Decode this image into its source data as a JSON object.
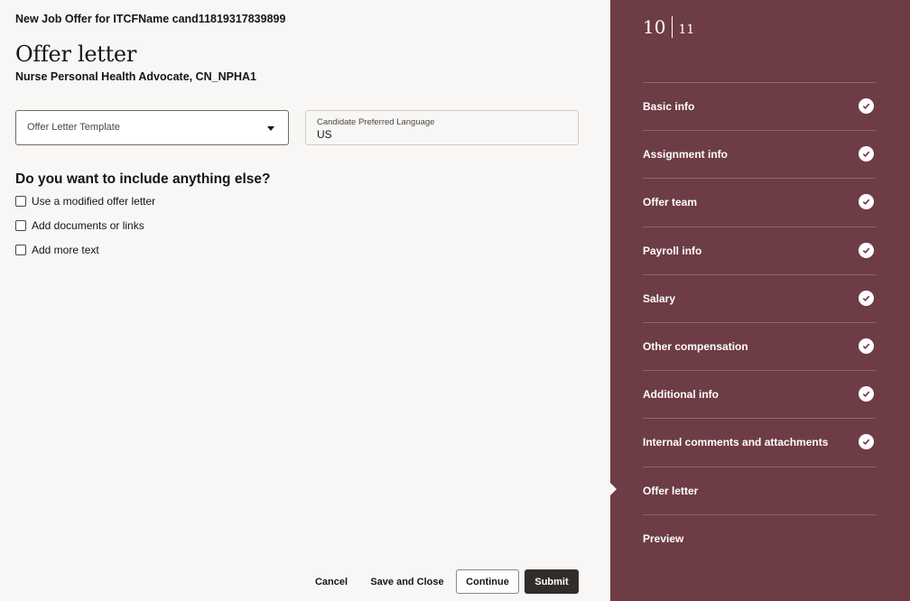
{
  "header": {
    "context": "New Job Offer for ITCFName cand11819317839899",
    "title": "Offer letter",
    "subtitle": "Nurse Personal Health Advocate, CN_NPHA1"
  },
  "form": {
    "template_placeholder": "Offer Letter Template",
    "language_label": "Candidate Preferred Language",
    "language_value": "US",
    "question": "Do you want to include anything else?",
    "options": [
      {
        "label": "Use a modified offer letter",
        "checked": false
      },
      {
        "label": "Add documents or links",
        "checked": false
      },
      {
        "label": "Add more text",
        "checked": false
      }
    ]
  },
  "footer": {
    "cancel": "Cancel",
    "save_close": "Save and Close",
    "continue": "Continue",
    "submit": "Submit"
  },
  "progress": {
    "current": "10",
    "total": "11",
    "steps": [
      {
        "label": "Basic info",
        "complete": true
      },
      {
        "label": "Assignment info",
        "complete": true
      },
      {
        "label": "Offer team",
        "complete": true
      },
      {
        "label": "Payroll info",
        "complete": true
      },
      {
        "label": "Salary",
        "complete": true
      },
      {
        "label": "Other compensation",
        "complete": true
      },
      {
        "label": "Additional info",
        "complete": true
      },
      {
        "label": "Internal comments and attachments",
        "complete": true
      },
      {
        "label": "Offer letter",
        "complete": false,
        "current": true
      },
      {
        "label": "Preview",
        "complete": false
      }
    ]
  },
  "colors": {
    "sidebar": "#6d3c45",
    "primary_button": "#312d2a"
  }
}
